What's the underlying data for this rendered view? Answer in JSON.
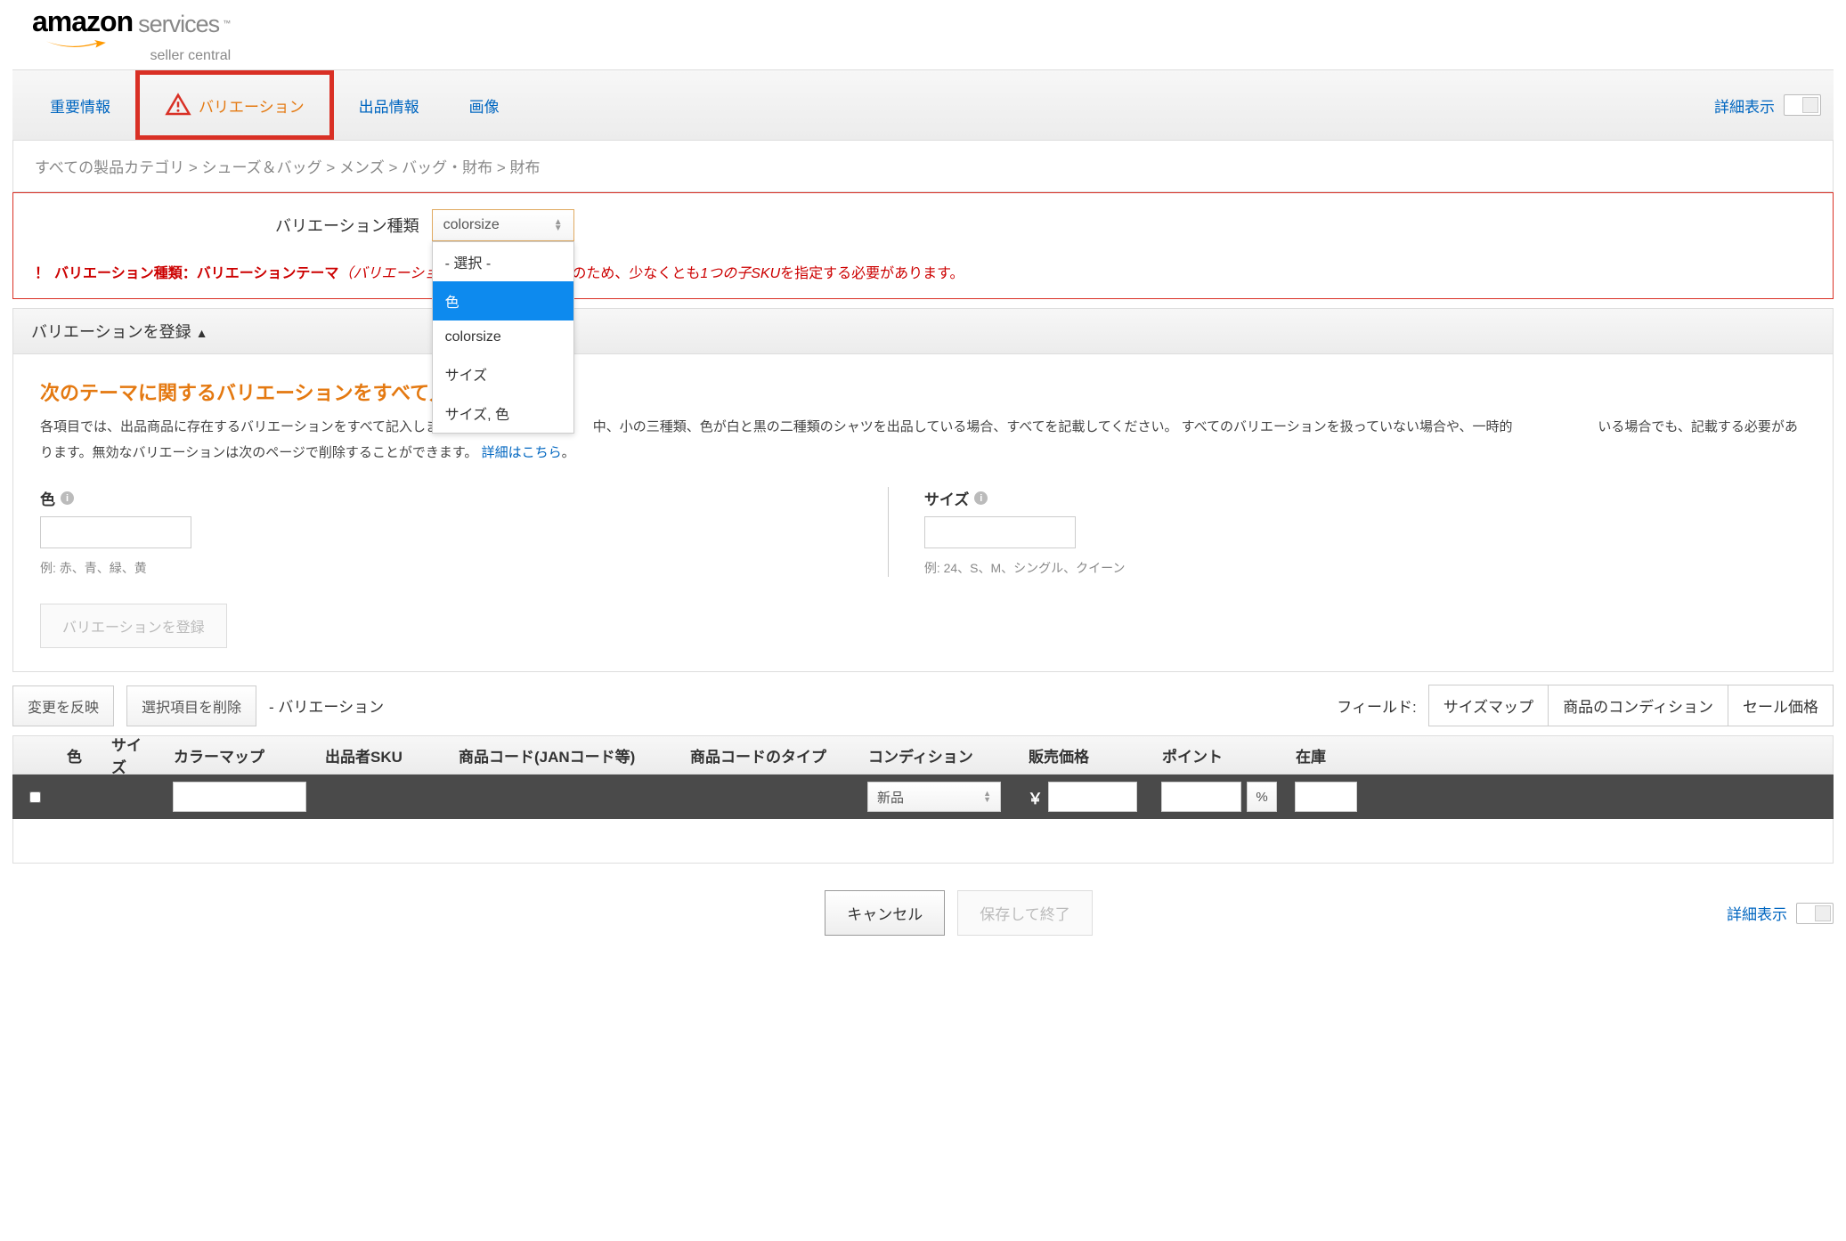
{
  "logo": {
    "main": "amazon",
    "sub": "services",
    "line2": "seller central"
  },
  "tabs": {
    "important": "重要情報",
    "variation": "バリエーション",
    "listing": "出品情報",
    "image": "画像"
  },
  "detail_toggle_label": "詳細表示",
  "breadcrumb": {
    "all": "すべての製品カテゴリ",
    "shoes": "シューズ＆バッグ",
    "mens": "メンズ",
    "bag": "バッグ・財布",
    "wallet": "財布"
  },
  "variation_type": {
    "label": "バリエーション種類",
    "selected": "colorsize",
    "options": [
      "- 選択 -",
      "色",
      "colorsize",
      "サイズ",
      "サイズ, 色"
    ],
    "highlighted_index": 1
  },
  "error": {
    "bang": "！",
    "prefix_bold": "バリエーション種類：バリエーションテーマ",
    "paren_italic": "（バリエーションのテ",
    "tail_a": "のため、少なくとも",
    "tail_italic": "1つの子SKU",
    "tail_b": "を指定する必要があります。"
  },
  "register_panel": {
    "header": "バリエーションを登録",
    "orange_heading": "次のテーマに関するバリエーションをすべて入",
    "orange_trail": "。",
    "help_a": "各項目では、出品商品に存在するバリエーションをすべて記入します。た",
    "help_b": "中、小の三種類、色が白と黒の二種類のシャツを出品している場合、すべてを記載してください。 すべてのバリエーションを扱っていない場合や、一時的",
    "help_c": "いる場合でも、記載する必要があります。無効なバリエーションは次のページで削除することができます。",
    "help_link": "詳細はこちら",
    "help_period": "。",
    "fields": {
      "color": {
        "label": "色",
        "example": "例: 赤、青、緑、黄"
      },
      "size": {
        "label": "サイズ",
        "example": "例: 24、S、M、シングル、クイーン"
      }
    },
    "register_btn": "バリエーションを登録"
  },
  "below": {
    "apply": "変更を反映",
    "delete": "選択項目を削除",
    "dash_label": "- バリエーション",
    "field_label": "フィールド:",
    "field_buttons": [
      "サイズマップ",
      "商品のコンディション",
      "セール価格"
    ]
  },
  "table": {
    "headers": {
      "color": "色",
      "size": "サイズ",
      "colormap": "カラーマップ",
      "sku": "出品者SKU",
      "code": "商品コード(JANコード等)",
      "codetype": "商品コードのタイプ",
      "cond": "コンディション",
      "price": "販売価格",
      "point": "ポイント",
      "stock": "在庫"
    },
    "row": {
      "condition_value": "新品",
      "currency": "￥",
      "pct": "%"
    }
  },
  "bottom": {
    "cancel": "キャンセル",
    "save": "保存して終了",
    "detail": "詳細表示"
  }
}
